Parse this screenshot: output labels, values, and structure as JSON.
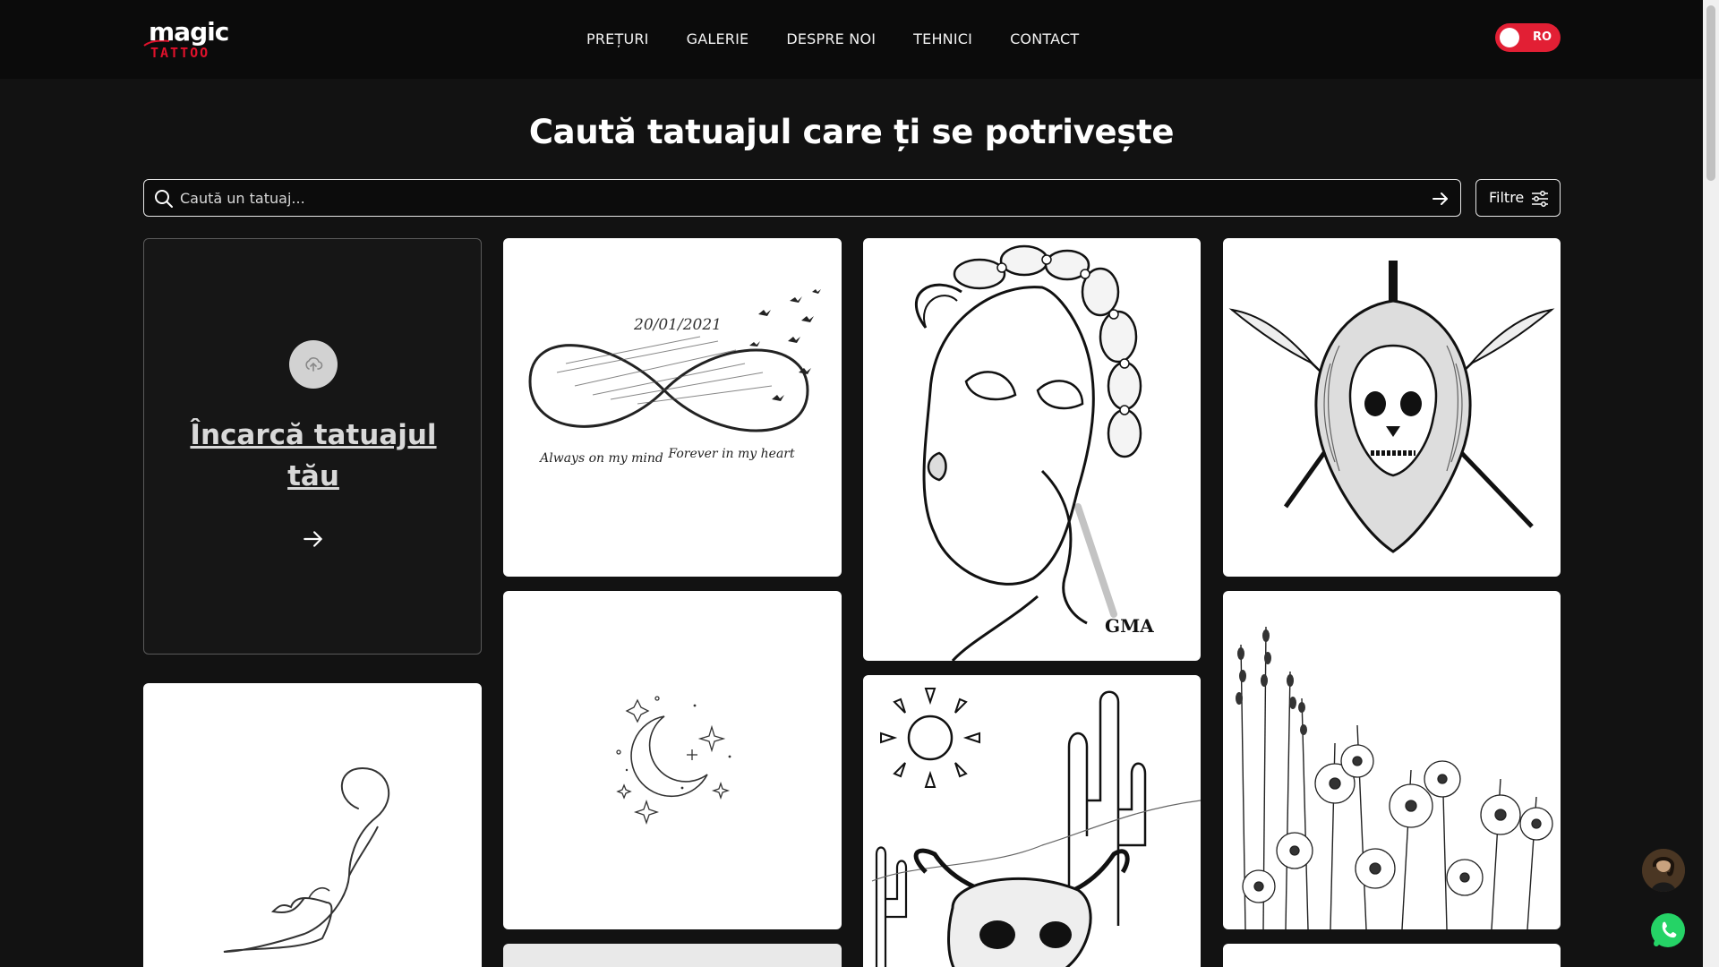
{
  "header": {
    "logo": {
      "line1": "magic",
      "line2": "TATTOO"
    },
    "nav": [
      "PREȚURI",
      "GALERIE",
      "DESPRE NOI",
      "TEHNICI",
      "CONTACT"
    ],
    "lang": "RO"
  },
  "main": {
    "title": "Caută tatuajul care ți se potrivește",
    "search": {
      "placeholder": "Caută un tatuaj..."
    },
    "filter_label": "Filtre",
    "upload": {
      "label": "Încarcă tatuajul tău"
    }
  },
  "gallery": {
    "feather_date": "20/01/2021",
    "feather_left": "Always on my mind",
    "feather_right": "Forever in my heart",
    "girl_signature": "GMA"
  },
  "icons": {
    "search": "search-icon",
    "arrow": "arrow-right-icon",
    "filter": "sliders-icon",
    "upload": "upload-cloud-icon",
    "whatsapp": "whatsapp-icon"
  },
  "colors": {
    "accent": "#e21f34",
    "background": "#121212",
    "header": "#0b0b0b"
  }
}
